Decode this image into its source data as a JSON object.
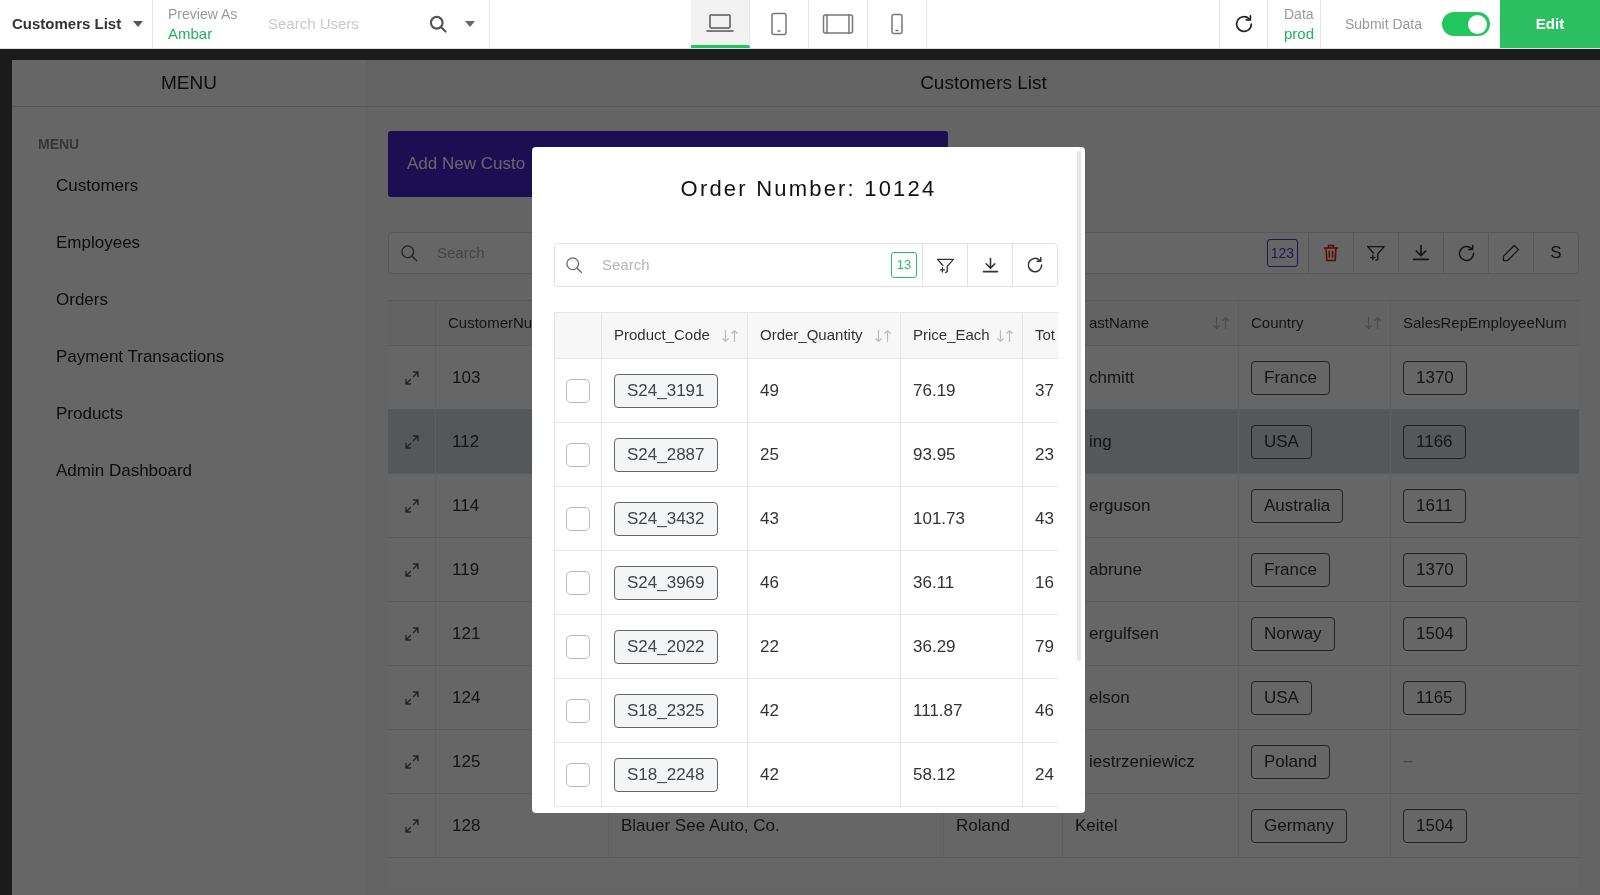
{
  "top_bar": {
    "page_select": "Customers List",
    "preview_as": {
      "label": "Preview As",
      "value": "Ambar"
    },
    "user_search": {
      "placeholder": "Search Users"
    },
    "devices": [
      {
        "kind": "laptop",
        "selected": true
      },
      {
        "kind": "tablet",
        "selected": false
      },
      {
        "kind": "tablet_landscape",
        "selected": false
      },
      {
        "kind": "phone",
        "selected": false
      }
    ],
    "data_env": {
      "label": "Data",
      "value": "prod"
    },
    "submit_data": {
      "label": "Submit Data",
      "on": true
    },
    "edit_button": "Edit"
  },
  "sidebar": {
    "header": "MENU",
    "section": "MENU",
    "items": [
      "Customers",
      "Employees",
      "Orders",
      "Payment Transactions",
      "Products",
      "Admin Dashboard"
    ]
  },
  "main": {
    "title": "Customers List",
    "add_button": "Add New Custo",
    "search": {
      "placeholder": "Search"
    },
    "toolbar": {
      "count": "123",
      "last_button": "S"
    },
    "table": {
      "columns": [
        {
          "label": "CustomerNu",
          "sortable": false
        },
        {
          "label": "astName",
          "sortable": true
        },
        {
          "label": "Country",
          "sortable": true
        },
        {
          "label": "SalesRepEmployeeNum",
          "sortable": false
        }
      ],
      "rows": [
        {
          "number": "103",
          "last_name": "chmitt",
          "country": "France",
          "sales_rep": "1370",
          "highlighted": false
        },
        {
          "number": "112",
          "last_name": "ing",
          "country": "USA",
          "sales_rep": "1166",
          "highlighted": true
        },
        {
          "number": "114",
          "last_name": "erguson",
          "country": "Australia",
          "sales_rep": "1611",
          "highlighted": false
        },
        {
          "number": "119",
          "last_name": "abrune",
          "country": "France",
          "sales_rep": "1370",
          "highlighted": false
        },
        {
          "number": "121",
          "last_name": "ergulfsen",
          "country": "Norway",
          "sales_rep": "1504",
          "highlighted": false
        },
        {
          "number": "124",
          "last_name": "elson",
          "country": "USA",
          "sales_rep": "1165",
          "highlighted": false
        },
        {
          "number": "125",
          "last_name": "iestrzeniewicz",
          "country": "Poland",
          "sales_rep": "--",
          "highlighted": false
        },
        {
          "number": "128",
          "name": "Blauer See Auto, Co.",
          "first_name": "Roland",
          "last_name": "Keitel",
          "country": "Germany",
          "sales_rep": "1504",
          "highlighted": false
        }
      ]
    }
  },
  "modal": {
    "title": "Order Number: 10124",
    "search": {
      "placeholder": "Search"
    },
    "count": "13",
    "columns": [
      {
        "label": "Product_Code",
        "sortable": true
      },
      {
        "label": "Order_Quantity",
        "sortable": true
      },
      {
        "label": "Price_Each",
        "sortable": true
      },
      {
        "label": "Tot",
        "sortable": false
      }
    ],
    "rows": [
      {
        "checked": false,
        "product_code": "S24_3191",
        "quantity": "49",
        "price": "76.19",
        "total": "37"
      },
      {
        "checked": false,
        "product_code": "S24_2887",
        "quantity": "25",
        "price": "93.95",
        "total": "23"
      },
      {
        "checked": false,
        "product_code": "S24_3432",
        "quantity": "43",
        "price": "101.73",
        "total": "43"
      },
      {
        "checked": false,
        "product_code": "S24_3969",
        "quantity": "46",
        "price": "36.11",
        "total": "16"
      },
      {
        "checked": false,
        "product_code": "S24_2022",
        "quantity": "22",
        "price": "36.29",
        "total": "79"
      },
      {
        "checked": false,
        "product_code": "S18_2325",
        "quantity": "42",
        "price": "111.87",
        "total": "46"
      },
      {
        "checked": false,
        "product_code": "S18_2248",
        "quantity": "42",
        "price": "58.12",
        "total": "24"
      }
    ]
  }
}
